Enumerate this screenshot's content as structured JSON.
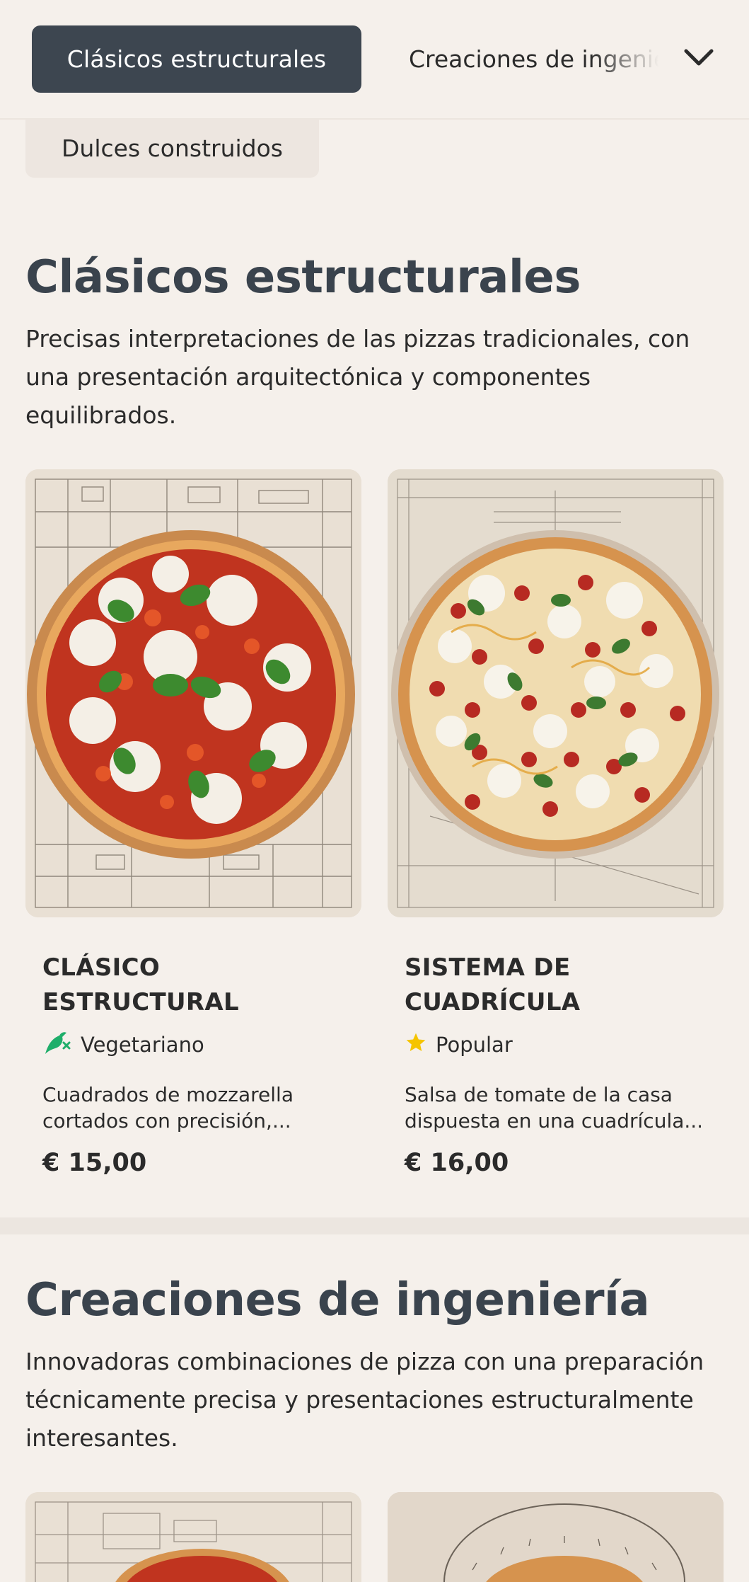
{
  "nav": {
    "active_tab": "Clásicos estructurales",
    "next_tab": "Creaciones de ingeniería",
    "overflow_tab": "Dulces construidos"
  },
  "colors": {
    "background": "#f5f0eb",
    "active_pill": "#3d4650",
    "heading": "#3a434d",
    "veg_icon": "#1fae6a",
    "star": "#f5c400"
  },
  "sections": [
    {
      "title": "Clásicos estructurales",
      "description": "Precisas interpretaciones de las pizzas tradicionales, con una presentación arquitectónica y componentes equilibrados.",
      "items": [
        {
          "name": "CLÁSICO ESTRUCTURAL",
          "tag": "Vegetariano",
          "tag_icon": "vegetarian-icon",
          "description": "Cuadrados de mozzarella cortados con precisión,...",
          "price": "€ 15,00"
        },
        {
          "name": "SISTEMA DE CUADRÍCULA",
          "tag": "Popular",
          "tag_icon": "star-icon",
          "description": "Salsa de tomate de la casa dispuesta en una cuadrícula...",
          "price": "€ 16,00"
        }
      ]
    },
    {
      "title": "Creaciones de ingeniería",
      "description": "Innovadoras combinaciones de pizza con una preparación técnicamente precisa y presentaciones estructuralmente interesantes."
    }
  ]
}
